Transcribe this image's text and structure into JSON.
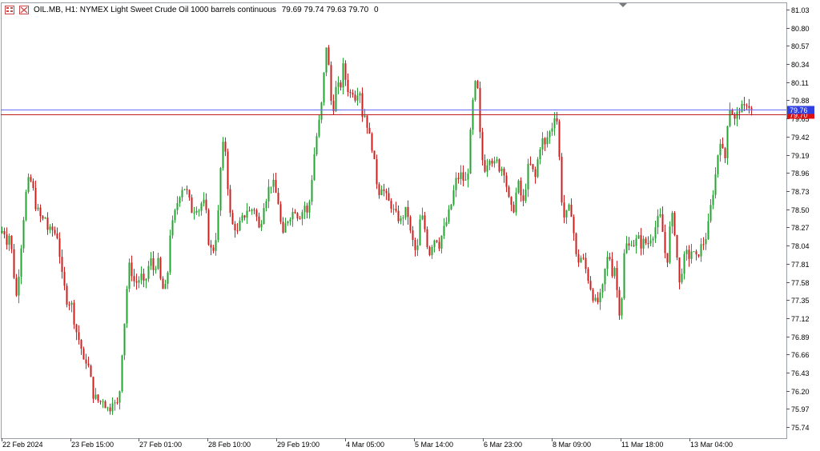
{
  "header": {
    "symbol": "OIL.MB, H1:",
    "description": "NYMEX Light Sweet Crude Oil 1000 barrels continuous",
    "ohlc": "79.69 79.74 79.63 79.70",
    "extra": "0",
    "icons": [
      "grid-menu-icon",
      "chart-type-icon"
    ]
  },
  "colors": {
    "bull": "#26a332",
    "bear": "#cc1f1f",
    "frame": "#9aa0a6",
    "bid_line": "#6b6bff",
    "ask_line": "#c01f1f",
    "bid_badge": "#3040e0",
    "ask_badge": "#e01010"
  },
  "chart_data": {
    "type": "candlestick",
    "title": "NYMEX Light Sweet Crude Oil 1000 barrels continuous",
    "symbol": "OIL.MB",
    "timeframe": "H1",
    "ylim": [
      75.6,
      81.12
    ],
    "y_ticks": [
      "81.03",
      "80.80",
      "80.57",
      "80.34",
      "80.11",
      "79.88",
      "79.65",
      "79.42",
      "79.19",
      "78.96",
      "78.73",
      "78.50",
      "78.27",
      "78.04",
      "77.81",
      "77.58",
      "77.35",
      "77.12",
      "76.89",
      "76.66",
      "76.43",
      "76.20",
      "75.97",
      "75.74"
    ],
    "x_ticks": [
      "22 Feb 2024",
      "23 Feb 15:00",
      "27 Feb 01:00",
      "28 Feb 10:00",
      "29 Feb 19:00",
      "4 Mar 05:00",
      "5 Mar 14:00",
      "6 Mar 23:00",
      "8 Mar 09:00",
      "11 Mar 18:00",
      "13 Mar 04:00"
    ],
    "price_lines": [
      {
        "name": "bid",
        "value": 79.7,
        "label": "79.70"
      },
      {
        "name": "ask",
        "value": 79.76,
        "label": "79.76"
      }
    ],
    "close_path": [
      [
        0,
        78.2
      ],
      [
        4,
        78.25
      ],
      [
        8,
        78.1
      ],
      [
        12,
        78.2
      ],
      [
        16,
        77.75
      ],
      [
        20,
        77.4
      ],
      [
        24,
        77.8
      ],
      [
        28,
        78.3
      ],
      [
        32,
        78.7
      ],
      [
        36,
        78.9
      ],
      [
        40,
        78.8
      ],
      [
        44,
        78.55
      ],
      [
        48,
        78.45
      ],
      [
        52,
        78.35
      ],
      [
        56,
        78.4
      ],
      [
        60,
        78.2
      ],
      [
        64,
        78.25
      ],
      [
        68,
        78.2
      ],
      [
        72,
        78.15
      ],
      [
        76,
        77.7
      ],
      [
        80,
        77.5
      ],
      [
        84,
        77.3
      ],
      [
        88,
        77.35
      ],
      [
        92,
        77.1
      ],
      [
        96,
        76.9
      ],
      [
        100,
        76.8
      ],
      [
        104,
        76.55
      ],
      [
        108,
        76.6
      ],
      [
        112,
        76.4
      ],
      [
        116,
        76.15
      ],
      [
        120,
        76.1
      ],
      [
        124,
        76.05
      ],
      [
        128,
        76.1
      ],
      [
        132,
        76.0
      ],
      [
        136,
        75.95
      ],
      [
        140,
        76.1
      ],
      [
        144,
        76.0
      ],
      [
        148,
        76.05
      ],
      [
        152,
        76.7
      ],
      [
        156,
        77.2
      ],
      [
        160,
        77.8
      ],
      [
        164,
        77.7
      ],
      [
        168,
        77.55
      ],
      [
        172,
        77.6
      ],
      [
        176,
        77.65
      ],
      [
        180,
        77.5
      ],
      [
        184,
        77.75
      ],
      [
        188,
        77.85
      ],
      [
        192,
        77.7
      ],
      [
        196,
        77.9
      ],
      [
        200,
        77.6
      ],
      [
        204,
        77.45
      ],
      [
        208,
        77.55
      ],
      [
        212,
        78.2
      ],
      [
        216,
        78.35
      ],
      [
        220,
        78.55
      ],
      [
        224,
        78.7
      ],
      [
        228,
        78.8
      ],
      [
        232,
        78.75
      ],
      [
        236,
        78.6
      ],
      [
        240,
        78.45
      ],
      [
        244,
        78.55
      ],
      [
        248,
        78.5
      ],
      [
        252,
        78.6
      ],
      [
        256,
        78.55
      ],
      [
        260,
        78.1
      ],
      [
        264,
        77.95
      ],
      [
        268,
        78.05
      ],
      [
        272,
        78.45
      ],
      [
        276,
        79.2
      ],
      [
        280,
        79.4
      ],
      [
        284,
        78.8
      ],
      [
        288,
        78.3
      ],
      [
        292,
        78.3
      ],
      [
        296,
        78.2
      ],
      [
        300,
        78.35
      ],
      [
        304,
        78.4
      ],
      [
        308,
        78.5
      ],
      [
        312,
        78.45
      ],
      [
        316,
        78.55
      ],
      [
        320,
        78.4
      ],
      [
        324,
        78.2
      ],
      [
        328,
        78.55
      ],
      [
        332,
        78.65
      ],
      [
        336,
        78.8
      ],
      [
        340,
        78.85
      ],
      [
        344,
        78.7
      ],
      [
        348,
        78.55
      ],
      [
        352,
        78.1
      ],
      [
        356,
        78.3
      ],
      [
        360,
        78.4
      ],
      [
        364,
        78.45
      ],
      [
        368,
        78.5
      ],
      [
        372,
        78.4
      ],
      [
        376,
        78.45
      ],
      [
        380,
        78.55
      ],
      [
        384,
        78.4
      ],
      [
        388,
        78.8
      ],
      [
        392,
        79.2
      ],
      [
        396,
        79.5
      ],
      [
        400,
        79.7
      ],
      [
        404,
        80.2
      ],
      [
        408,
        80.7
      ],
      [
        412,
        79.9
      ],
      [
        416,
        79.8
      ],
      [
        420,
        80.1
      ],
      [
        424,
        80.0
      ],
      [
        428,
        80.3
      ],
      [
        432,
        80.1
      ],
      [
        436,
        79.95
      ],
      [
        440,
        80.0
      ],
      [
        444,
        79.9
      ],
      [
        448,
        80.1
      ],
      [
        452,
        79.7
      ],
      [
        456,
        79.7
      ],
      [
        460,
        79.45
      ],
      [
        464,
        79.3
      ],
      [
        468,
        79.0
      ],
      [
        472,
        78.7
      ],
      [
        476,
        78.8
      ],
      [
        480,
        78.7
      ],
      [
        484,
        78.6
      ],
      [
        488,
        78.55
      ],
      [
        492,
        78.45
      ],
      [
        496,
        78.4
      ],
      [
        500,
        78.35
      ],
      [
        504,
        78.45
      ],
      [
        508,
        78.5
      ],
      [
        512,
        78.2
      ],
      [
        516,
        78.05
      ],
      [
        520,
        77.9
      ],
      [
        524,
        78.35
      ],
      [
        528,
        78.4
      ],
      [
        532,
        78.1
      ],
      [
        536,
        77.95
      ],
      [
        540,
        78.1
      ],
      [
        544,
        78.15
      ],
      [
        548,
        78.05
      ],
      [
        552,
        78.2
      ],
      [
        556,
        78.3
      ],
      [
        560,
        78.45
      ],
      [
        564,
        78.6
      ],
      [
        568,
        78.85
      ],
      [
        572,
        78.9
      ],
      [
        576,
        78.95
      ],
      [
        580,
        78.8
      ],
      [
        584,
        79.0
      ],
      [
        588,
        79.6
      ],
      [
        592,
        80.1
      ],
      [
        596,
        80.0
      ],
      [
        600,
        79.25
      ],
      [
        604,
        79.0
      ],
      [
        608,
        79.1
      ],
      [
        612,
        79.2
      ],
      [
        616,
        79.05
      ],
      [
        620,
        79.1
      ],
      [
        624,
        79.0
      ],
      [
        628,
        79.05
      ],
      [
        632,
        78.8
      ],
      [
        636,
        78.55
      ],
      [
        640,
        78.45
      ],
      [
        644,
        78.7
      ],
      [
        648,
        78.85
      ],
      [
        652,
        78.5
      ],
      [
        656,
        78.8
      ],
      [
        660,
        79.1
      ],
      [
        664,
        79.0
      ],
      [
        668,
        78.9
      ],
      [
        672,
        79.2
      ],
      [
        676,
        79.4
      ],
      [
        680,
        79.3
      ],
      [
        684,
        79.45
      ],
      [
        688,
        79.5
      ],
      [
        692,
        79.7
      ],
      [
        696,
        79.6
      ],
      [
        700,
        78.7
      ],
      [
        704,
        78.4
      ],
      [
        708,
        78.45
      ],
      [
        712,
        78.55
      ],
      [
        716,
        78.2
      ],
      [
        720,
        77.8
      ],
      [
        724,
        77.9
      ],
      [
        728,
        77.85
      ],
      [
        732,
        77.7
      ],
      [
        736,
        77.55
      ],
      [
        740,
        77.4
      ],
      [
        744,
        77.3
      ],
      [
        748,
        77.35
      ],
      [
        752,
        77.5
      ],
      [
        756,
        77.8
      ],
      [
        760,
        77.95
      ],
      [
        764,
        77.7
      ],
      [
        768,
        77.8
      ],
      [
        772,
        77.15
      ],
      [
        776,
        77.4
      ],
      [
        780,
        78.1
      ],
      [
        784,
        78.0
      ],
      [
        788,
        78.1
      ],
      [
        792,
        78.05
      ],
      [
        796,
        78.15
      ],
      [
        800,
        78.05
      ],
      [
        804,
        78.1
      ],
      [
        808,
        78.05
      ],
      [
        812,
        78.15
      ],
      [
        816,
        78.2
      ],
      [
        820,
        78.35
      ],
      [
        824,
        78.4
      ],
      [
        828,
        78.15
      ],
      [
        832,
        77.75
      ],
      [
        836,
        78.25
      ],
      [
        840,
        78.45
      ],
      [
        844,
        78.0
      ],
      [
        848,
        77.55
      ],
      [
        852,
        77.8
      ],
      [
        856,
        77.95
      ],
      [
        860,
        77.9
      ],
      [
        864,
        78.0
      ],
      [
        868,
        77.85
      ],
      [
        872,
        77.95
      ],
      [
        876,
        78.05
      ],
      [
        880,
        78.1
      ],
      [
        884,
        78.3
      ],
      [
        888,
        78.6
      ],
      [
        892,
        78.85
      ],
      [
        896,
        79.2
      ],
      [
        900,
        79.45
      ],
      [
        904,
        79.0
      ],
      [
        908,
        79.6
      ],
      [
        912,
        79.85
      ],
      [
        916,
        79.6
      ],
      [
        920,
        79.7
      ],
      [
        924,
        79.8
      ],
      [
        928,
        79.75
      ],
      [
        932,
        79.85
      ],
      [
        936,
        79.8
      ],
      [
        940,
        79.7
      ]
    ]
  }
}
